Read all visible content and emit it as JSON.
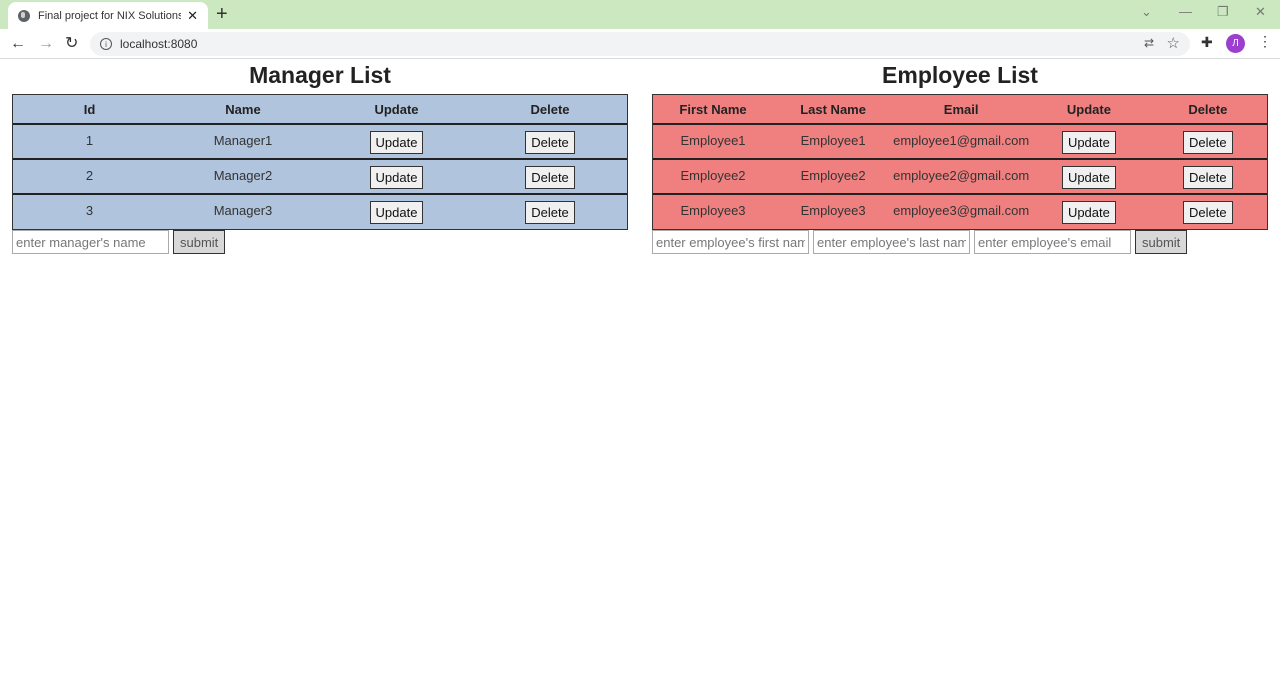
{
  "browser": {
    "tab_title": "Final project for NIX Solutions!",
    "url": "localhost:8080",
    "avatar_letter": "Л"
  },
  "managers": {
    "title": "Manager List",
    "headers": [
      "Id",
      "Name",
      "Update",
      "Delete"
    ],
    "rows": [
      {
        "id": "1",
        "name": "Manager1",
        "update": "Update",
        "delete": "Delete"
      },
      {
        "id": "2",
        "name": "Manager2",
        "update": "Update",
        "delete": "Delete"
      },
      {
        "id": "3",
        "name": "Manager3",
        "update": "Update",
        "delete": "Delete"
      }
    ],
    "form": {
      "name_placeholder": "enter manager's name",
      "submit_label": "submit"
    },
    "color": "#b0c4de"
  },
  "employees": {
    "title": "Employee List",
    "headers": [
      "First Name",
      "Last Name",
      "Email",
      "Update",
      "Delete"
    ],
    "rows": [
      {
        "first": "Employee1",
        "last": "Employee1",
        "email": "employee1@gmail.com",
        "update": "Update",
        "delete": "Delete"
      },
      {
        "first": "Employee2",
        "last": "Employee2",
        "email": "employee2@gmail.com",
        "update": "Update",
        "delete": "Delete"
      },
      {
        "first": "Employee3",
        "last": "Employee3",
        "email": "employee3@gmail.com",
        "update": "Update",
        "delete": "Delete"
      }
    ],
    "form": {
      "first_placeholder": "enter employee's first name",
      "last_placeholder": "enter employee's last name",
      "email_placeholder": "enter employee's email",
      "submit_label": "submit"
    },
    "color": "#f08080"
  }
}
